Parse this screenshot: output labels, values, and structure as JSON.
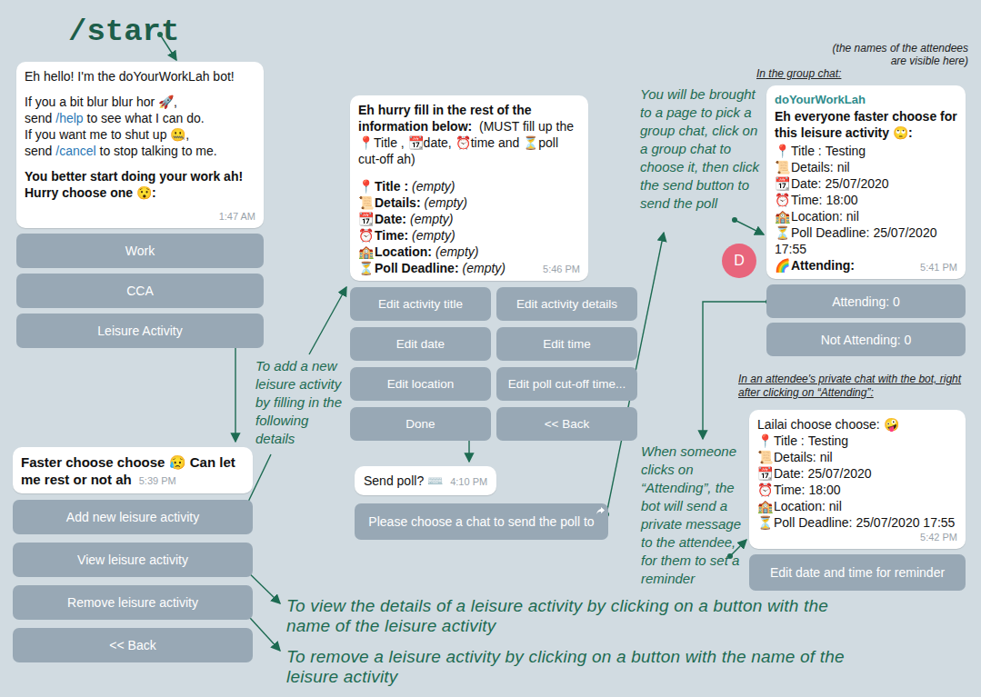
{
  "command": "/start",
  "welcome": {
    "paragraphs": [
      [
        [
          {
            "text": "Eh hello! I'm the doYourWorkLah bot!",
            "kind": "plain"
          }
        ]
      ],
      [
        [
          {
            "text": "If you a bit blur blur hor 🚀,",
            "kind": "plain"
          }
        ],
        [
          {
            "text": "send ",
            "kind": "plain"
          },
          {
            "text": "/help",
            "kind": "link"
          },
          {
            "text": " to see what I can do.",
            "kind": "plain"
          }
        ],
        [
          {
            "text": "If you want me to shut up 🤐,",
            "kind": "plain"
          }
        ],
        [
          {
            "text": "send ",
            "kind": "plain"
          },
          {
            "text": "/cancel",
            "kind": "link"
          },
          {
            "text": " to stop talking to me.",
            "kind": "plain"
          }
        ]
      ],
      [
        [
          {
            "text": "You better start doing your work ah! Hurry choose one 😯:",
            "kind": "bold"
          }
        ]
      ]
    ],
    "time": "1:47 AM"
  },
  "main_menu": [
    {
      "label": "Work"
    },
    {
      "label": "CCA"
    },
    {
      "label": "Leisure Activity"
    }
  ],
  "leisure_menu": {
    "message": "Faster choose choose 😥 Can let me rest or not ah",
    "time": "5:39 PM",
    "buttons": [
      {
        "label": "Add new leisure activity"
      },
      {
        "label": "View leisure activity"
      },
      {
        "label": "Remove leisure activity"
      },
      {
        "label": "<< Back"
      }
    ]
  },
  "add_form": {
    "intro": [
      {
        "text": "Eh hurry fill in the rest of the information below:",
        "kind": "bold"
      },
      {
        "text": "  (MUST fill up the 📍Title , 📆date, ⏰time and ⏳poll cut-off ah)",
        "kind": "plain"
      }
    ],
    "fields": [
      {
        "icon": "📍",
        "label": "Title :",
        "value": "(empty)"
      },
      {
        "icon": "📜",
        "label": "Details:",
        "value": "(empty)"
      },
      {
        "icon": "📆",
        "label": "Date:",
        "value": "(empty)"
      },
      {
        "icon": "⏰",
        "label": "Time:",
        "value": "(empty)"
      },
      {
        "icon": "🏫",
        "label": "Location:",
        "value": "(empty)"
      },
      {
        "icon": "⏳",
        "label": "Poll Deadline:",
        "value": "(empty)"
      }
    ],
    "time": "5:46 PM",
    "buttons": [
      {
        "label": "Edit activity title"
      },
      {
        "label": "Edit activity details"
      },
      {
        "label": "Edit date"
      },
      {
        "label": "Edit time"
      },
      {
        "label": "Edit location"
      },
      {
        "label": "Edit poll cut-off time..."
      },
      {
        "label": "Done"
      },
      {
        "label": "<< Back"
      }
    ]
  },
  "send_poll": {
    "message": "Send poll?",
    "icon": "⌨️",
    "time": "4:10 PM",
    "button": "Please choose a chat to send the poll to"
  },
  "group_chat": {
    "label": "In the group chat:",
    "note": "(the names of the attendees are visible here)",
    "sender": "doYourWorkLah",
    "avatar": "D",
    "title": "Eh everyone faster choose for this leisure activity 🙄:",
    "fields": [
      {
        "icon": "📍",
        "label": "Title :",
        "value": "Testing"
      },
      {
        "icon": "📜",
        "label": "Details:",
        "value": "nil"
      },
      {
        "icon": "📆",
        "label": "Date:",
        "value": "25/07/2020"
      },
      {
        "icon": "⏰",
        "label": "Time:",
        "value": "18:00"
      },
      {
        "icon": "🏫",
        "label": "Location:",
        "value": "nil"
      },
      {
        "icon": "⏳",
        "label": "Poll Deadline:",
        "value": "25/07/2020 17:55"
      }
    ],
    "attending": {
      "icon": "🌈",
      "label": "Attending:"
    },
    "time": "5:41 PM",
    "buttons": [
      {
        "label": "Attending: 0"
      },
      {
        "label": "Not Attending: 0"
      }
    ]
  },
  "private_chat": {
    "label": "In an attendee's private chat with the bot, right after clicking on “Attending”:",
    "title": "Lailai choose choose: 🤪",
    "fields": [
      {
        "icon": "📍",
        "label": "Title :",
        "value": "Testing"
      },
      {
        "icon": "📜",
        "label": "Details:",
        "value": "nil"
      },
      {
        "icon": "📆",
        "label": "Date:",
        "value": "25/07/2020"
      },
      {
        "icon": "⏰",
        "label": "Time:",
        "value": "18:00"
      },
      {
        "icon": "🏫",
        "label": "Location:",
        "value": "nil"
      },
      {
        "icon": "⏳",
        "label": "Poll Deadline:",
        "value": "25/07/2020 17:55"
      }
    ],
    "time": "5:42 PM",
    "button": "Edit date and time for reminder"
  },
  "annotations": {
    "add": "To add a new leisure activity by filling in the following details",
    "pick": "You will be brought to a page to pick a group chat, click on a group chat to choose it, then click the send button to send the poll",
    "attend": "When someone clicks on “Attending”, the bot will send a private message to the attendee, for them to set a reminder",
    "view": "To view the details of a leisure activity by clicking on a button with the name of the leisure activity",
    "remove": "To remove a leisure activity by clicking on a button with the name of the leisure activity"
  }
}
